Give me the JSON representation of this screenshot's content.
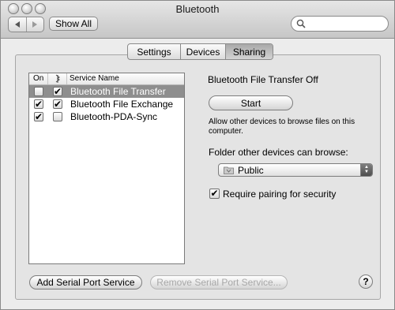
{
  "window": {
    "title": "Bluetooth"
  },
  "toolbar": {
    "back_icon": "back-arrow-icon",
    "forward_icon": "forward-arrow-icon",
    "show_all_label": "Show All",
    "search_value": "",
    "search_placeholder": ""
  },
  "tabs": [
    {
      "label": "Settings",
      "selected": false
    },
    {
      "label": "Devices",
      "selected": false
    },
    {
      "label": "Sharing",
      "selected": true
    }
  ],
  "services": {
    "columns": {
      "on": "On",
      "visible_icon": "visibility-icon",
      "name": "Service Name"
    },
    "rows": [
      {
        "name": "Bluetooth File Transfer",
        "on": false,
        "visible": true,
        "selected": true
      },
      {
        "name": "Bluetooth File Exchange",
        "on": true,
        "visible": true,
        "selected": false
      },
      {
        "name": "Bluetooth-PDA-Sync",
        "on": true,
        "visible": false,
        "selected": false
      }
    ]
  },
  "detail": {
    "status": "Bluetooth File Transfer Off",
    "start_label": "Start",
    "description": "Allow other devices to browse files on this computer.",
    "folder_label": "Folder other devices can browse:",
    "folder_value": "Public",
    "folder_icon": "folder-icon",
    "require_pairing_label": "Require pairing for security",
    "require_pairing_checked": true
  },
  "bottom": {
    "add_label": "Add Serial Port Service",
    "remove_label": "Remove Serial Port Service...",
    "remove_enabled": false,
    "help_label": "?"
  },
  "check_glyph": "✔"
}
